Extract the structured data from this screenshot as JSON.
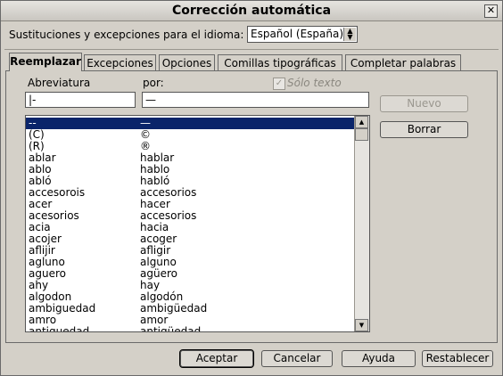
{
  "window": {
    "title": "Corrección automática"
  },
  "language": {
    "label": "Sustituciones y excepciones para el idioma:",
    "selected": "Español (España)"
  },
  "tabs": [
    {
      "label": "Reemplazar"
    },
    {
      "label": "Excepciones"
    },
    {
      "label": "Opciones"
    },
    {
      "label": "Comillas tipográficas"
    },
    {
      "label": "Completar palabras"
    }
  ],
  "replace": {
    "abbr_label": "Abreviatura",
    "by_label": "por:",
    "abbr_value": "|-",
    "by_value": "—",
    "text_only_label": "Sólo texto",
    "new_button": "Nuevo",
    "delete_button": "Borrar"
  },
  "list": [
    {
      "from": "--",
      "to": "—"
    },
    {
      "from": "(C)",
      "to": "©"
    },
    {
      "from": "(R)",
      "to": "®"
    },
    {
      "from": "ablar",
      "to": "hablar"
    },
    {
      "from": "ablo",
      "to": "hablo"
    },
    {
      "from": "abló",
      "to": "habló"
    },
    {
      "from": "accesorois",
      "to": "accesorios"
    },
    {
      "from": "acer",
      "to": "hacer"
    },
    {
      "from": "acesorios",
      "to": "accesorios"
    },
    {
      "from": "acia",
      "to": "hacia"
    },
    {
      "from": "acojer",
      "to": "acoger"
    },
    {
      "from": "aflijir",
      "to": "afligir"
    },
    {
      "from": "agluno",
      "to": "alguno"
    },
    {
      "from": "aguero",
      "to": "agüero"
    },
    {
      "from": "ahy",
      "to": "hay"
    },
    {
      "from": "algodon",
      "to": "algodón"
    },
    {
      "from": "ambiguedad",
      "to": "ambigüedad"
    },
    {
      "from": "amro",
      "to": "amor"
    },
    {
      "from": "antiguedad",
      "to": "antigüedad"
    }
  ],
  "footer": {
    "accept": "Aceptar",
    "cancel": "Cancelar",
    "help": "Ayuda",
    "reset": "Restablecer"
  }
}
